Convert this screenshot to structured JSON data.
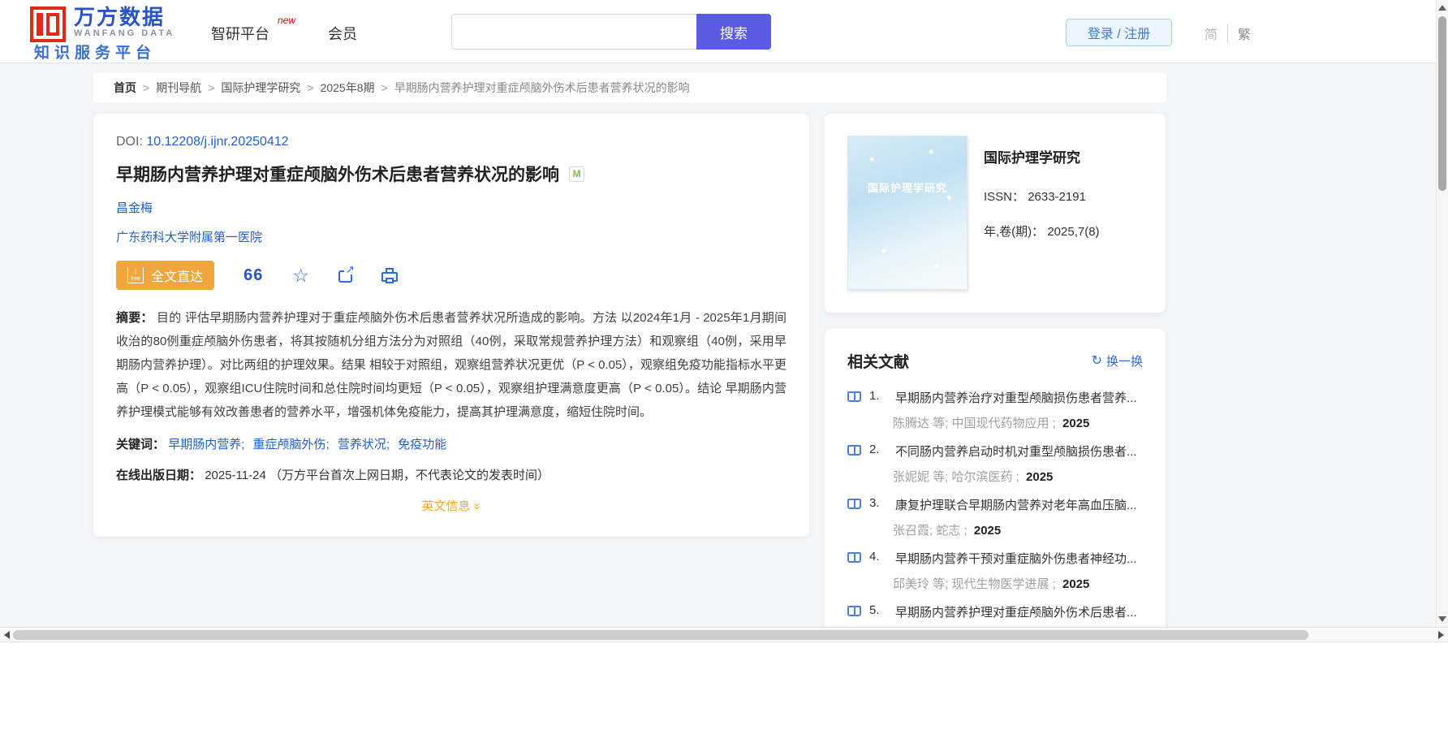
{
  "header": {
    "logo": {
      "brand_cn": "万方数据",
      "brand_en": "WANFANG DATA",
      "tagline": "知识服务平台"
    },
    "nav": [
      {
        "label": "智研平台",
        "badge": "new"
      },
      {
        "label": "会员"
      }
    ],
    "search": {
      "value": "",
      "button_label": "搜索"
    },
    "auth": {
      "login_register": "登录 / 注册",
      "simplified": "简",
      "traditional": "繁"
    }
  },
  "breadcrumb": {
    "separator": ">",
    "items": [
      "首页",
      "期刊导航",
      "国际护理学研究",
      "2025年8期",
      "早期肠内营养护理对重症颅脑外伤术后患者营养状况的影响"
    ]
  },
  "article": {
    "doi_label": "DOI:",
    "doi": "10.12208/j.ijnr.20250412",
    "title": "早期肠内营养护理对重症颅脑外伤术后患者营养状况的影响",
    "badge": "M",
    "author": "昌金梅",
    "affiliation": "广东药科大学附属第一医院",
    "toolbar": {
      "fulltext_label": "全文直达",
      "free_text": "free",
      "arrow_glyph": "↓",
      "quote_icon_text": "66",
      "star_glyph": "☆",
      "share_arrow_glyph": "↗"
    },
    "abstract_label": "摘要：",
    "abstract": "目的 评估早期肠内营养护理对于重症颅脑外伤术后患者营养状况所造成的影响。方法 以2024年1月 - 2025年1月期间收治的80例重症颅脑外伤患者，将其按随机分组方法分为对照组（40例，采取常规营养护理方法）和观察组（40例，采用早期肠内营养护理）。对比两组的护理效果。结果 相较于对照组，观察组营养状况更优（P < 0.05），观察组免疫功能指标水平更高（P < 0.05），观察组ICU住院时间和总住院时间均更短（P < 0.05），观察组护理满意度更高（P < 0.05）。结论 早期肠内营养护理模式能够有效改善患者的营养水平，增强机体免疫能力，提高其护理满意度，缩短住院时间。",
    "keywords_label": "关键词：",
    "keywords_separator": ";",
    "keywords": [
      "早期肠内营养",
      "重症颅脑外伤",
      "营养状况",
      "免疫功能"
    ],
    "online_date_label": "在线出版日期：",
    "online_date": "2025-11-24",
    "online_date_note": "（万方平台首次上网日期，不代表论文的发表时间）",
    "english_info_label": "英文信息",
    "english_info_chevron": "»"
  },
  "journal": {
    "cover_title": "国际护理学研究",
    "name": "国际护理学研究",
    "issn_label": "ISSN：",
    "issn": "2633-2191",
    "volume_label": "年,卷(期)：",
    "volume": "2025,7(8)"
  },
  "related": {
    "title": "相关文献",
    "refresh_label": "换一换",
    "refresh_glyph": "↻",
    "items": [
      {
        "num": "1.",
        "title": "早期肠内营养治疗对重型颅脑损伤患者营养...",
        "authors": "陈腾达 等;",
        "journal": "中国现代药物应用 ;",
        "year": "2025"
      },
      {
        "num": "2.",
        "title": "不同肠内营养启动时机对重型颅脑损伤患者...",
        "authors": "张妮妮 等;",
        "journal": "哈尔滨医药 ;",
        "year": "2025"
      },
      {
        "num": "3.",
        "title": "康复护理联合早期肠内营养对老年高血压脑...",
        "authors": "张召霞;",
        "journal": "蛇志 ;",
        "year": "2025"
      },
      {
        "num": "4.",
        "title": "早期肠内营养干预对重症脑外伤患者神经功...",
        "authors": "邱美玲 等;",
        "journal": "现代生物医学进展 ;",
        "year": "2025"
      },
      {
        "num": "5.",
        "title": "早期肠内营养护理对重症颅脑外伤术后患者...",
        "authors": "",
        "journal": "",
        "year": ""
      }
    ]
  },
  "colors": {
    "accent_purple": "#5b5ce2",
    "link_blue": "#2160d2",
    "icon_blue": "#2f6bd8",
    "orange_button": "#efa63c",
    "orange_text": "#f5a623",
    "logo_red": "#e0281c",
    "logo_blue": "#2953c6",
    "page_bg": "#f4f5f7"
  }
}
